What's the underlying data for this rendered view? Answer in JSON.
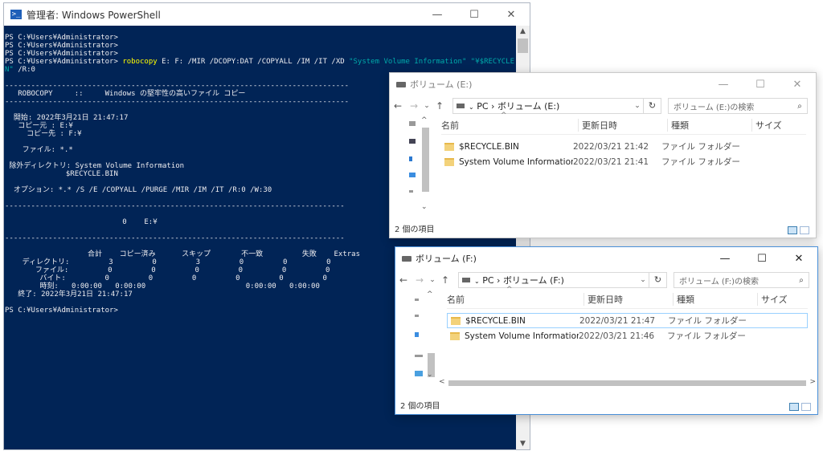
{
  "powershell": {
    "title": "管理者: Windows PowerShell",
    "icon": "powershell-icon",
    "controls": {
      "minimize": "—",
      "maximize": "☐",
      "close": "✕"
    },
    "prompt_lines": [
      "PS C:¥Users¥Administrator>",
      "PS C:¥Users¥Administrator>",
      "PS C:¥Users¥Administrator>"
    ],
    "command_prompt": "PS C:¥Users¥Administrator> ",
    "command_name": "robocopy",
    "command_args": " E: F: /MIR /DCOPY:DAT /COPYALL /IM /IT /XD ",
    "command_str": "\"System Volume Information\" \"¥$RECYCLE.BI",
    "command_wrap_str": "N\"",
    "command_wrap_rest": " /R:0",
    "output": [
      "",
      "-------------------------------------------------------------------------------",
      "   ROBOCOPY     ::     Windows の堅牢性の高いファイル コピー",
      "-------------------------------------------------------------------------------",
      "",
      "  開始: 2022年3月21日 21:47:17",
      "   コピー元 : E:¥",
      "     コピー先 : F:¥",
      "",
      "    ファイル: *.*",
      "",
      " 除外ディレクトリ: System Volume Information",
      "              $RECYCLE.BIN",
      "",
      "  オプション: *.* /S /E /COPYALL /PURGE /MIR /IM /IT /R:0 /W:30",
      "",
      "------------------------------------------------------------------------------",
      "",
      "                           0    E:¥",
      "",
      "------------------------------------------------------------------------------",
      "",
      "                   合計    コピー済み      スキップ       不一致         失敗    Extras",
      "    ディレクトリ:         3         0         3         0         0         0",
      "       ファイル:         0         0         0         0         0         0",
      "        バイト:         0         0         0         0         0         0",
      "        時刻:   0:00:00   0:00:00                       0:00:00   0:00:00",
      "   終了: 2022年3月21日 21:47:17",
      "",
      "PS C:¥Users¥Administrator>"
    ]
  },
  "explorer_e": {
    "title": "ボリューム (E:)",
    "path_pc": "PC",
    "path_sep": "›",
    "path_drive": "ボリューム (E:)",
    "search_placeholder": "ボリューム (E:)の検索",
    "columns": {
      "name": "名前",
      "date": "更新日時",
      "type": "種類",
      "size": "サイズ"
    },
    "items": [
      {
        "name": "$RECYCLE.BIN",
        "date": "2022/03/21 21:42",
        "type": "ファイル フォルダー"
      },
      {
        "name": "System Volume Information",
        "date": "2022/03/21 21:41",
        "type": "ファイル フォルダー"
      }
    ],
    "status": "2 個の項目"
  },
  "explorer_f": {
    "title": "ボリューム (F:)",
    "path_pc": "PC",
    "path_sep": "›",
    "path_drive": "ボリューム (F:)",
    "search_placeholder": "ボリューム (F:)の検索",
    "columns": {
      "name": "名前",
      "date": "更新日時",
      "type": "種類",
      "size": "サイズ"
    },
    "items": [
      {
        "name": "$RECYCLE.BIN",
        "date": "2022/03/21 21:47",
        "type": "ファイル フォルダー"
      },
      {
        "name": "System Volume Information",
        "date": "2022/03/21 21:46",
        "type": "ファイル フォルダー"
      }
    ],
    "status": "2 個の項目"
  },
  "nav": {
    "back": "←",
    "forward": "→",
    "recent": "⌄",
    "up": "↑",
    "refresh": "↻",
    "dropdown": "⌄",
    "search_icon": "⌕"
  },
  "colors": {
    "console_bg": "#012456",
    "console_fg": "#eeedf0",
    "command": "#ffff00",
    "string": "#00aaaa"
  }
}
